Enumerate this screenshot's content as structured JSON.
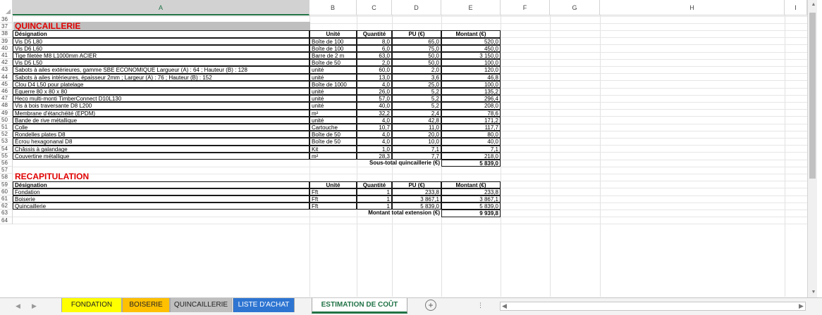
{
  "columns": [
    "A",
    "B",
    "C",
    "D",
    "E",
    "F",
    "G",
    "H",
    "I"
  ],
  "row_numbers": [
    "36",
    "37",
    "38",
    "39",
    "40",
    "41",
    "42",
    "43",
    "44",
    "45",
    "46",
    "47",
    "48",
    "49",
    "50",
    "51",
    "52",
    "53",
    "54",
    "55",
    "56",
    "57",
    "58",
    "59",
    "60",
    "61",
    "62",
    "63",
    "64"
  ],
  "quincaillerie": {
    "title": "QUINCAILLERIE",
    "headers": {
      "designation": "Désignation",
      "unite": "Unité",
      "quantite": "Quantité",
      "pu": "PU (€)",
      "montant": "Montant (€)"
    },
    "rows": [
      [
        "Vis D5 L80",
        "Boîte de 100",
        "8,0",
        "65,0",
        "520,0"
      ],
      [
        "Vis D6 L60",
        "Boîte de 100",
        "6,0",
        "75,0",
        "450,0"
      ],
      [
        "Tige filetée M8 L1000mm ACIER",
        "Barre de 2 m",
        "63,0",
        "50,0",
        "3 150,0"
      ],
      [
        "Vis D5 L50",
        "Boîte de 50",
        "2,0",
        "50,0",
        "100,0"
      ],
      [
        "Sabots à ailes extérieures, gamme SBE ECONOMIQUE Largueur (A) : 64 ; Hauteur (B) : 128",
        "unité",
        "60,0",
        "2,0",
        "120,0"
      ],
      [
        "Sabots à ailes intérieures, épaisseur 2mm ; Largeur (A) : 76 ; Hauteur (B) : 152",
        "unité",
        "13,0",
        "3,6",
        "46,8"
      ],
      [
        "Clou D4 L50 pour platelage",
        "Boîte de 1000",
        "4,0",
        "25,0",
        "100,0"
      ],
      [
        "Equerre 80 x 80 x 80",
        "unité",
        "26,0",
        "5,2",
        "135,2"
      ],
      [
        "Heco multi-monti TimberConnect D10L130",
        "unité",
        "57,0",
        "5,2",
        "296,4"
      ],
      [
        "Vis à bois traversante D8 L200",
        "unité",
        "40,0",
        "5,2",
        "208,0"
      ],
      [
        "Membrane d'étanchéité (EPDM)",
        "m²",
        "32,2",
        "2,4",
        "78,6"
      ],
      [
        "Bande de rive métallique",
        "unité",
        "4,0",
        "42,8",
        "171,2"
      ],
      [
        "Colle",
        "Cartouche",
        "10,7",
        "11,0",
        "117,7"
      ],
      [
        "Rondelles plates D8",
        "Boîte de 50",
        "4,0",
        "20,0",
        "80,0"
      ],
      [
        "Écrou hexagonanal D8",
        "Boîte de 50",
        "4,0",
        "10,0",
        "40,0"
      ],
      [
        "Châssis à galandage",
        "Kit",
        "1,0",
        "7,1",
        "7,1"
      ],
      [
        "Couvertine métallique",
        "m²",
        "28,3",
        "7,7",
        "218,0"
      ]
    ],
    "subtotal_label": "Sous-total quincaillerie (€)",
    "subtotal_value": "5 839,0"
  },
  "recap": {
    "title": "RECAPITULATION",
    "headers": {
      "designation": "Désignation",
      "unite": "Unité",
      "quantite": "Quantité",
      "pu": "PU (€)",
      "montant": "Montant (€)"
    },
    "rows": [
      [
        "Fondation",
        "Fft",
        "1",
        "233,8",
        "233,8"
      ],
      [
        "Boiserie",
        "Fft",
        "1",
        "3 867,1",
        "3 867,1"
      ],
      [
        "Quincaillerie",
        "Fft",
        "1",
        "5 839,0",
        "5 839,0"
      ]
    ],
    "total_label": "Montant total extension (€)",
    "total_value": "9 939,8"
  },
  "tabs": [
    {
      "label": "FONDATION",
      "color": "#ffff00"
    },
    {
      "label": "BOISERIE",
      "color": "#ffc000"
    },
    {
      "label": "QUINCAILLERIE",
      "color": "#bfbfbf"
    },
    {
      "label": "LISTE D'ACHAT",
      "color": "#2e75d2"
    },
    {
      "label": "ESTIMATION DE COÛT",
      "color": "#ffffff"
    }
  ],
  "add_sheet_symbol": "+",
  "colors": {
    "accent": "#217346",
    "section_title": "#e00000"
  }
}
